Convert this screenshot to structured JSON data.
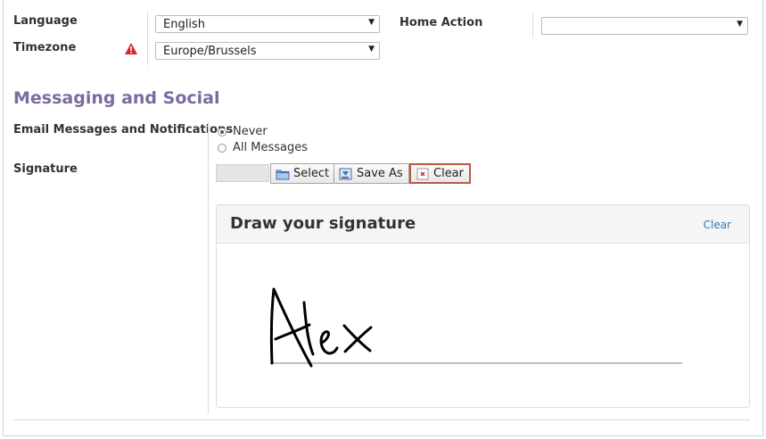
{
  "preferences": {
    "language_label": "Language",
    "language_value": "English",
    "timezone_label": "Timezone",
    "timezone_value": "Europe/Brussels",
    "home_action_label": "Home Action",
    "home_action_value": ""
  },
  "messaging": {
    "section_title": "Messaging and Social",
    "email_label": "Email Messages and Notifications",
    "options": [
      {
        "label": "Never",
        "checked": true
      },
      {
        "label": "All Messages",
        "checked": false
      }
    ],
    "signature_label": "Signature"
  },
  "toolbar": {
    "select_label": "Select",
    "save_as_label": "Save As",
    "clear_label": "Clear"
  },
  "signature_panel": {
    "title": "Draw your signature",
    "clear_link": "Clear",
    "signature_image": "handwritten signature 'Alex'"
  },
  "colors": {
    "section_title": "#7c6ba0",
    "link": "#337ab7",
    "warning": "#d9262c",
    "clear_border": "#b85a40"
  }
}
